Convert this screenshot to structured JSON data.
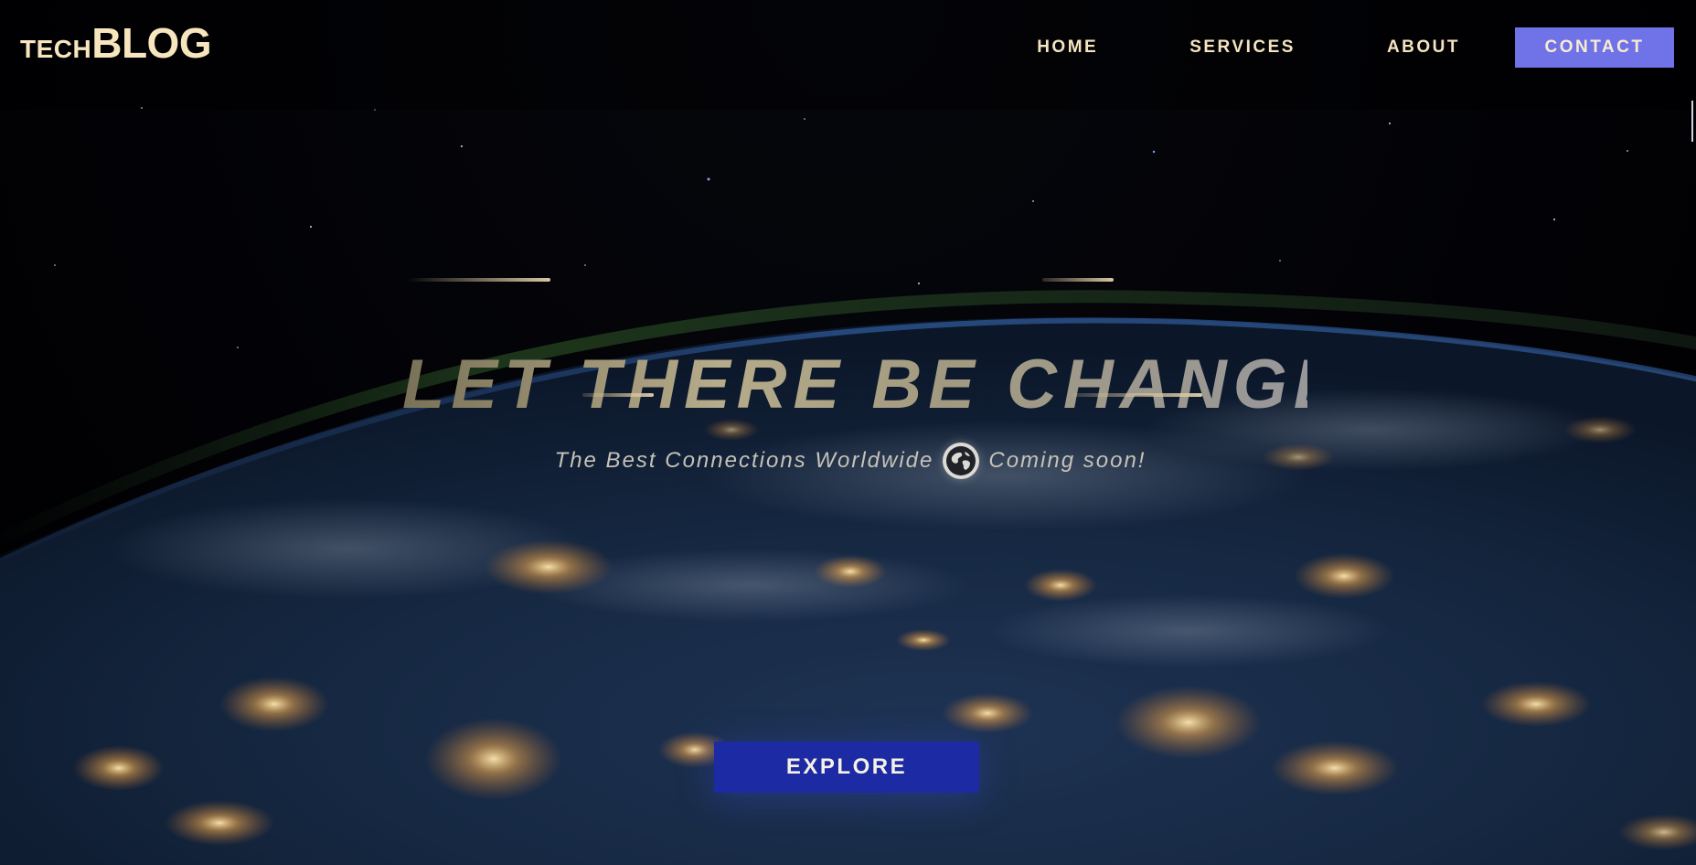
{
  "header": {
    "logo_small": "TECH",
    "logo_big": "BLOG",
    "nav": [
      "HOME",
      "SERVICES",
      "ABOUT"
    ],
    "contact_label": "CONTACT"
  },
  "hero": {
    "title": "LET THERE BE CHANGE",
    "subtitle_left": "The Best Connections Worldwide",
    "subtitle_right": "Coming soon!",
    "icon": "globe-icon",
    "cta_label": "EXPLORE"
  },
  "colors": {
    "logo_text": "#f7e6bd",
    "nav_text": "#f4e4bf",
    "contact_bg": "#6f73e7",
    "explore_bg": "#1c2aa3"
  }
}
